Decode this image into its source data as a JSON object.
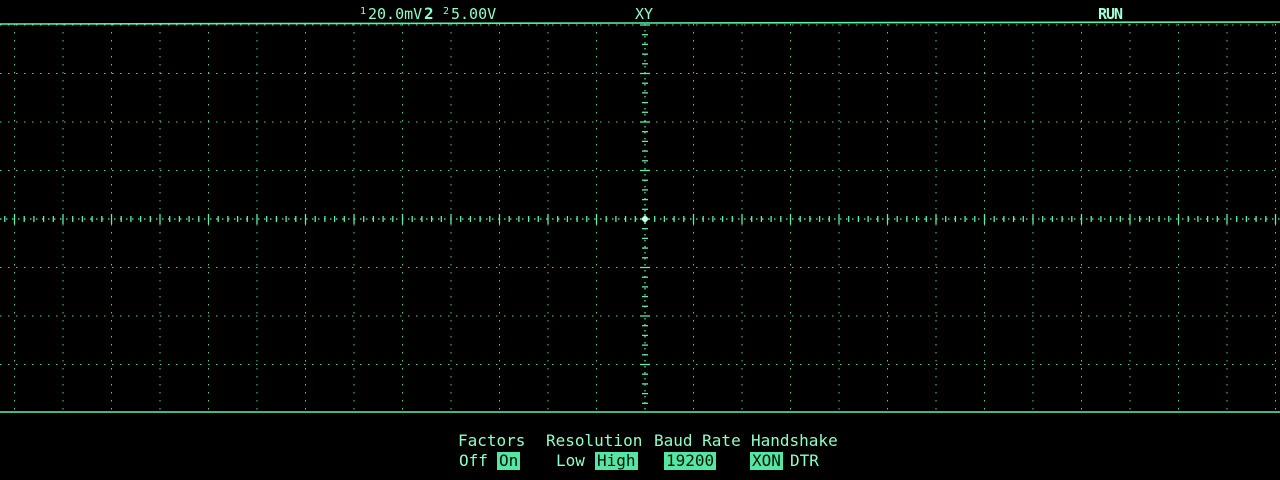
{
  "status": {
    "ch1_scale": "20.0mV",
    "ch2_number": "2",
    "ch2_scale": "5.00V",
    "mode": "XY",
    "run_state": "RUN"
  },
  "icons": {
    "ch1_marker": "channel-marker-icon",
    "ch2_marker": "channel-marker-icon"
  },
  "colors": {
    "trace": "#5af2a6",
    "background": "#000000",
    "highlight": "#56e6a4"
  },
  "softkeys": {
    "factors": {
      "label": "Factors",
      "options": [
        "Off",
        "On"
      ],
      "selected": "On"
    },
    "resolution": {
      "label": "Resolution",
      "options": [
        "Low",
        "High"
      ],
      "selected": "High"
    },
    "baud_rate": {
      "label": "Baud Rate",
      "value": "19200"
    },
    "handshake": {
      "label": "Handshake",
      "options": [
        "XON",
        "DTR"
      ],
      "selected": "XON"
    }
  }
}
